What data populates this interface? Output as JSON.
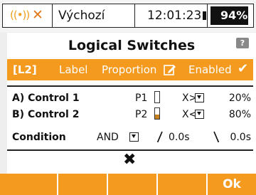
{
  "status_bar": {
    "signal_icon": "signal-x-icon",
    "profile": "Výchozí",
    "time": "12:01:23",
    "battery": "94%",
    "battery_level": 0.94
  },
  "screen": {
    "title": "Logical Switches",
    "help_icon": "help-icon"
  },
  "header": {
    "id": "[L2]",
    "label": "Label",
    "proportion": "Proportion",
    "edit_icon": "pencil-icon",
    "enabled": "Enabled",
    "check_icon": "check-icon"
  },
  "controls": [
    {
      "label": "A) Control 1",
      "param": "P1",
      "level": 0.0,
      "comparator": "X>",
      "value": "20%"
    },
    {
      "label": "B) Control 2",
      "param": "P2",
      "level": 0.4,
      "comparator": "X<",
      "value": "80%"
    }
  ],
  "condition": {
    "label": "Condition",
    "operator": "AND",
    "rise_delay": "0.0s",
    "fall_delay": "0.0s"
  },
  "delete_icon": "close-icon",
  "softkeys": {
    "ok": "Ok"
  },
  "colors": {
    "accent": "#f39a1f",
    "gauge_fill": "#c68020"
  }
}
